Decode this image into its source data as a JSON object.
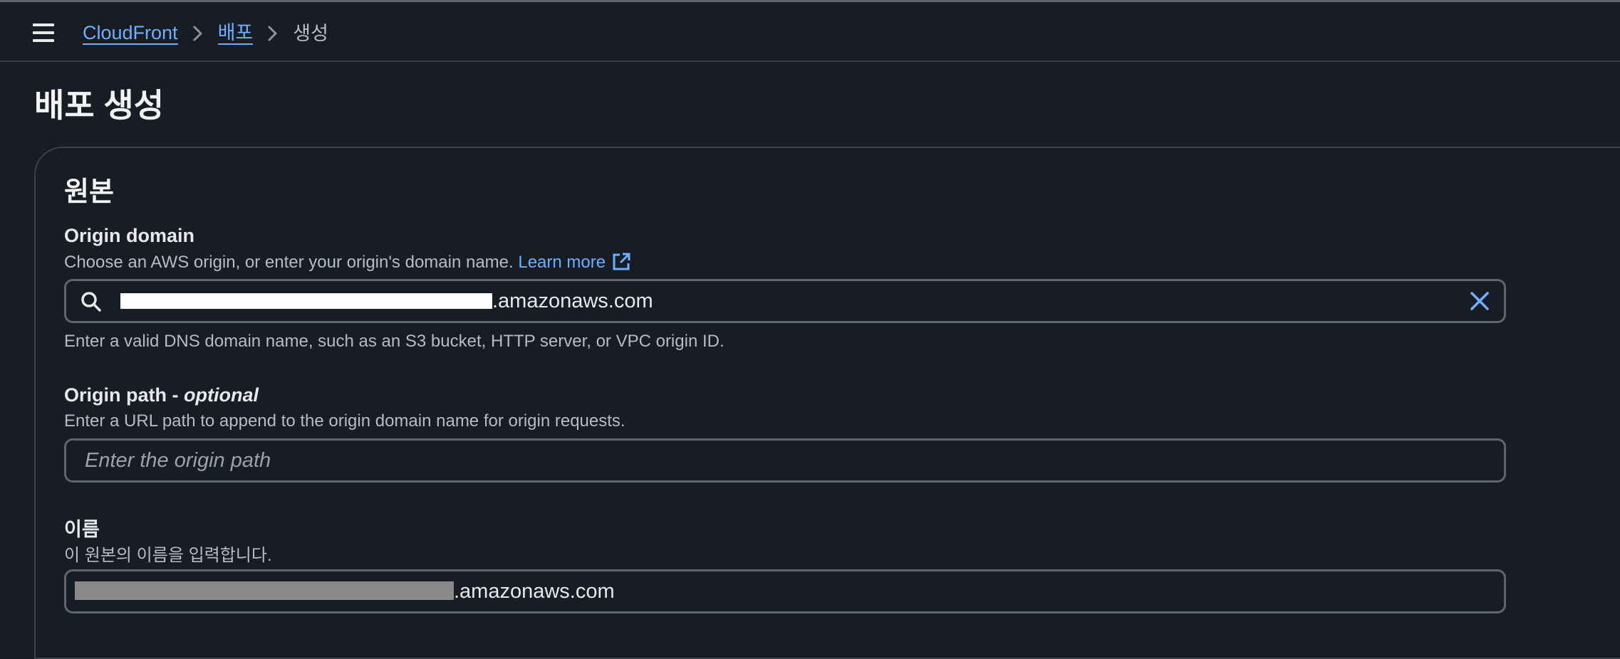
{
  "breadcrumb": {
    "items": [
      "CloudFront",
      "배포",
      "생성"
    ]
  },
  "page": {
    "title": "배포 생성"
  },
  "section": {
    "title": "원본"
  },
  "origin_domain": {
    "label": "Origin domain",
    "description": "Choose an AWS origin, or enter your origin's domain name.",
    "learn_more": "Learn more",
    "value_suffix": ".amazonaws.com",
    "hint": "Enter a valid DNS domain name, such as an S3 bucket, HTTP server, or VPC origin ID."
  },
  "origin_path": {
    "label": "Origin path - ",
    "label_optional": "optional",
    "description": "Enter a URL path to append to the origin domain name for origin requests.",
    "placeholder": "Enter the origin path"
  },
  "name": {
    "label": "이름",
    "description": "이 원본의 이름을 입력합니다.",
    "value_suffix": ".amazonaws.com"
  },
  "colors": {
    "background": "#181c24",
    "link": "#6cb0ff",
    "border": "#5f6570"
  },
  "icons": [
    "menu-icon",
    "chevron-right-icon",
    "external-link-icon",
    "search-icon",
    "close-icon"
  ]
}
